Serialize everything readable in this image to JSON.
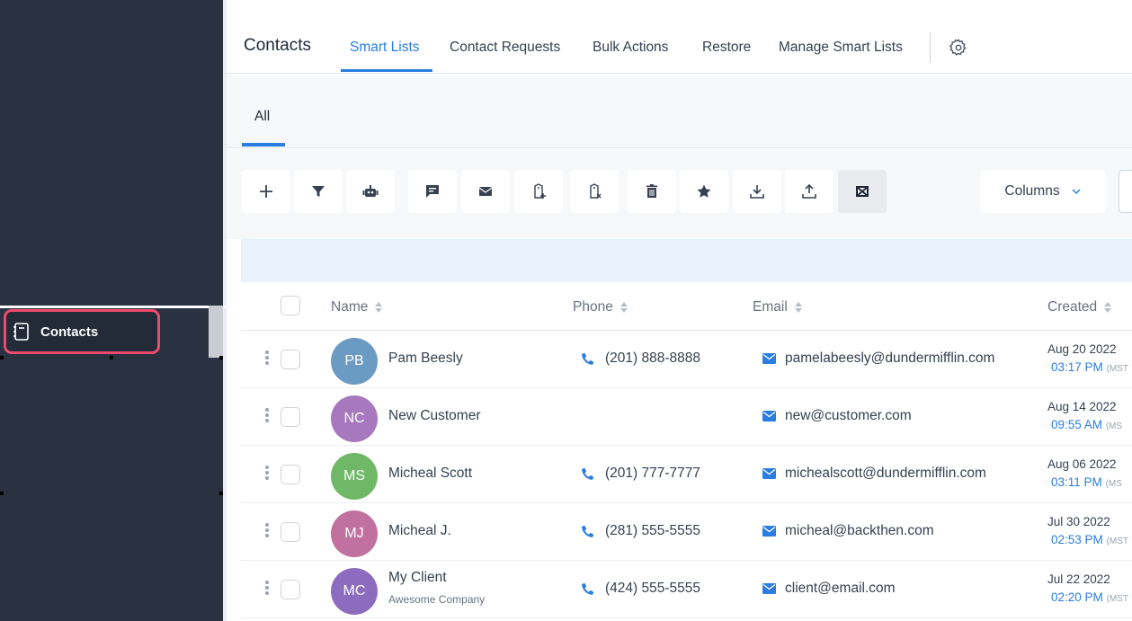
{
  "sidebar": {
    "active_item": {
      "label": "Contacts",
      "icon": "contacts-book-icon"
    }
  },
  "header": {
    "title": "Contacts",
    "tabs": [
      {
        "label": "Smart Lists",
        "active": true
      },
      {
        "label": "Contact Requests"
      },
      {
        "label": "Bulk Actions"
      },
      {
        "label": "Restore"
      },
      {
        "label": "Manage Smart Lists"
      }
    ],
    "settings_icon": "gear-icon"
  },
  "subtabs": {
    "all_label": "All"
  },
  "toolbar": {
    "buttons": [
      "add-icon",
      "filter-icon",
      "robot-icon",
      "message-icon",
      "mail-icon",
      "add-tag-icon",
      "remove-tag-icon",
      "trash-icon",
      "star-icon",
      "download-icon",
      "upload-icon",
      "merge-icon"
    ],
    "columns_label": "Columns"
  },
  "table": {
    "columns": [
      "Name",
      "Phone",
      "Email",
      "Created"
    ],
    "rows": [
      {
        "initials": "PB",
        "name": "Pam Beesly",
        "company": "",
        "phone": "(201) 888-8888",
        "email": "pamelabeesly@dundermifflin.com",
        "created_date": "Aug 20 2022",
        "created_time": "03:17 PM",
        "tz": "(MST",
        "avatar_color": "#6b9bc3"
      },
      {
        "initials": "NC",
        "name": "New Customer",
        "company": "",
        "phone": "",
        "email": "new@customer.com",
        "created_date": "Aug 14 2022",
        "created_time": "09:55 AM",
        "tz": "(MS",
        "avatar_color": "#a778bd"
      },
      {
        "initials": "MS",
        "name": "Micheal Scott",
        "company": "",
        "phone": "(201) 777-7777",
        "email": "michealscott@dundermifflin.com",
        "created_date": "Aug 06 2022",
        "created_time": "03:11 PM",
        "tz": "(MS",
        "avatar_color": "#6fb868"
      },
      {
        "initials": "MJ",
        "name": "Micheal J.",
        "company": "",
        "phone": "(281) 555-5555",
        "email": "micheal@backthen.com",
        "created_date": "Jul 30 2022",
        "created_time": "02:53 PM",
        "tz": "(MST",
        "avatar_color": "#c0719f"
      },
      {
        "initials": "MC",
        "name": "My Client",
        "company": "Awesome Company",
        "phone": "(424) 555-5555",
        "email": "client@email.com",
        "created_date": "Jul 22 2022",
        "created_time": "02:20 PM",
        "tz": "(MST",
        "avatar_color": "#8d6cc0"
      }
    ]
  },
  "colors": {
    "accent": "#2a7de1",
    "sidebar": "#2a3141",
    "highlight": "#ee4b6c"
  }
}
